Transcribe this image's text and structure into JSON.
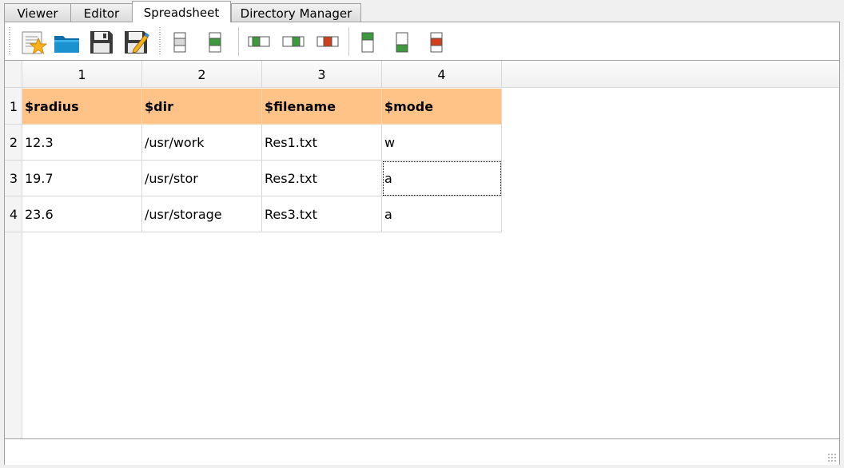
{
  "tabs": [
    {
      "label": "Viewer"
    },
    {
      "label": "Editor"
    },
    {
      "label": "Spreadsheet"
    },
    {
      "label": "Directory Manager"
    }
  ],
  "active_tab": "Spreadsheet",
  "toolbar": {
    "icons": [
      "new-file-icon",
      "open-folder-icon",
      "save-icon",
      "save-as-icon",
      "insert-row-above-icon",
      "insert-row-below-icon",
      "insert-column-left-icon",
      "insert-column-right-icon",
      "delete-column-icon",
      "copy-row-icon",
      "add-row-icon",
      "delete-row-icon"
    ]
  },
  "colors": {
    "header_fill": "#ffc387",
    "accent_green": "#3c9a3c",
    "accent_red": "#d0401c"
  },
  "spreadsheet": {
    "column_headers": [
      "1",
      "2",
      "3",
      "4"
    ],
    "row_headers": [
      "1",
      "2",
      "3",
      "4"
    ],
    "rows": [
      [
        "$radius",
        "$dir",
        "$filename",
        "$mode"
      ],
      [
        "12.3",
        "/usr/work",
        "Res1.txt",
        "w"
      ],
      [
        "19.7",
        "/usr/stor",
        "Res2.txt",
        "a"
      ],
      [
        "23.6",
        "/usr/storage",
        "Res3.txt",
        "a"
      ]
    ],
    "selected_cell": {
      "row": 3,
      "col": 4
    }
  }
}
